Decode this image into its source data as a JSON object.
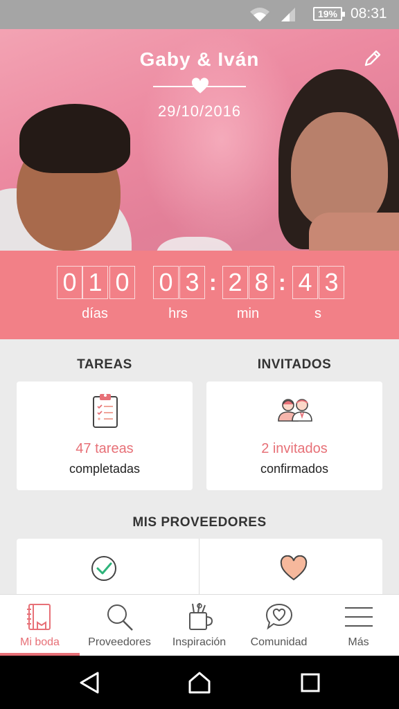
{
  "status_bar": {
    "battery": "19%",
    "time": "08:31"
  },
  "header": {
    "couple_names": "Gaby & Iván",
    "date": "29/10/2016"
  },
  "countdown": {
    "days_digits": [
      "0",
      "1",
      "0"
    ],
    "hours_digits": [
      "0",
      "3"
    ],
    "minutes_digits": [
      "2",
      "8"
    ],
    "seconds_digits": [
      "4",
      "3"
    ],
    "separator": ":",
    "labels": {
      "days": "días",
      "hours": "hrs",
      "minutes": "min",
      "seconds": "s"
    }
  },
  "tasks": {
    "title": "TAREAS",
    "count": "47 tareas",
    "caption": "completadas"
  },
  "guests": {
    "title": "INVITADOS",
    "count": "2 invitados",
    "caption": "confirmados"
  },
  "providers": {
    "title": "MIS PROVEEDORES"
  },
  "bottom_nav": [
    {
      "label": "Mi boda",
      "icon": "notebook-icon",
      "active": true
    },
    {
      "label": "Proveedores",
      "icon": "search-icon",
      "active": false
    },
    {
      "label": "Inspiración",
      "icon": "inspiration-icon",
      "active": false
    },
    {
      "label": "Comunidad",
      "icon": "chat-heart-icon",
      "active": false
    },
    {
      "label": "Más",
      "icon": "menu-icon",
      "active": false
    }
  ],
  "colors": {
    "accent": "#e77077",
    "countdown_bg": "#f28087",
    "statusbar": "#a5a5a5"
  }
}
